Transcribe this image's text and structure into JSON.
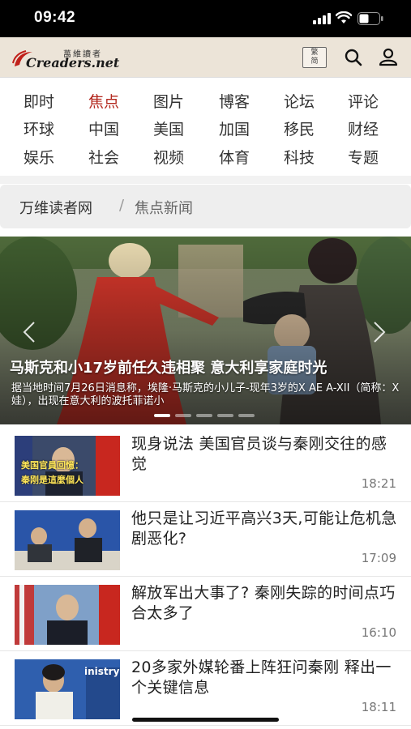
{
  "status_bar": {
    "time": "09:42"
  },
  "header": {
    "logo_cn": "萬維讀者",
    "logo_en": "Creaders.net",
    "lang_toggle": "繁\n简"
  },
  "categories": [
    {
      "label": "即时",
      "active": false
    },
    {
      "label": "焦点",
      "active": true
    },
    {
      "label": "图片",
      "active": false
    },
    {
      "label": "博客",
      "active": false
    },
    {
      "label": "论坛",
      "active": false
    },
    {
      "label": "评论",
      "active": false
    },
    {
      "label": "环球",
      "active": false
    },
    {
      "label": "中国",
      "active": false
    },
    {
      "label": "美国",
      "active": false
    },
    {
      "label": "加国",
      "active": false
    },
    {
      "label": "移民",
      "active": false
    },
    {
      "label": "财经",
      "active": false
    },
    {
      "label": "娱乐",
      "active": false
    },
    {
      "label": "社会",
      "active": false
    },
    {
      "label": "视频",
      "active": false
    },
    {
      "label": "体育",
      "active": false
    },
    {
      "label": "科技",
      "active": false
    },
    {
      "label": "专题",
      "active": false
    }
  ],
  "breadcrumb": {
    "home": "万维读者网",
    "separator": "/",
    "current": "焦点新闻"
  },
  "hero": {
    "title": "马斯克和小17岁前任久违相聚 意大利享家庭时光",
    "summary": "据当地时间7月26日消息称，埃隆·马斯克的小儿子-现年3岁的X AE A-XII（简称：X娃），出现在意大利的波托菲诺小",
    "slide_count": 5,
    "active_slide": 0
  },
  "news": [
    {
      "title": "现身说法 美国官员谈与秦刚交往的感觉",
      "time": "18:21",
      "thumb_caption_1": "美国官員回憶：",
      "thumb_caption_2": "秦刚是這麼個人"
    },
    {
      "title": "他只是让习近平高兴3天,可能让危机急剧恶化?",
      "time": "17:09"
    },
    {
      "title": "解放军出大事了? 秦刚失踪的时间点巧合太多了",
      "time": "16:10"
    },
    {
      "title": "20多家外媒轮番上阵狂问秦刚 释出一个关键信息",
      "time": "18:11",
      "thumb_caption_1": "inistry"
    }
  ],
  "colors": {
    "accent": "#b3281e",
    "header_bg": "#ece4d8",
    "breadcrumb_bg": "#eeeeee"
  }
}
